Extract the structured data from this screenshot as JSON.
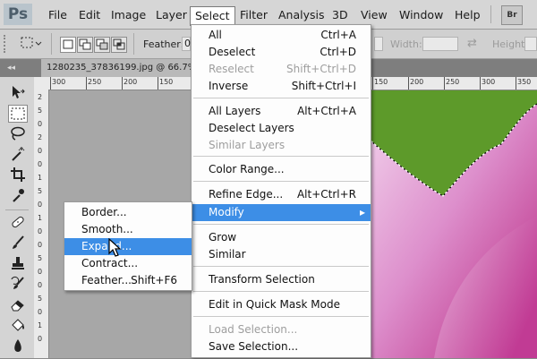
{
  "app": {
    "logo": "Ps"
  },
  "menubar": {
    "items": [
      "File",
      "Edit",
      "Image",
      "Layer",
      "Select",
      "Filter",
      "Analysis",
      "3D",
      "View",
      "Window",
      "Help"
    ],
    "bridge": "Br"
  },
  "options_bar": {
    "feather_label": "Feather:",
    "feather_value": "0",
    "width_label": "Width:",
    "height_label": "Height:"
  },
  "document": {
    "tab_title": "1280235_37836199.jpg @ 66.7%"
  },
  "rulers": {
    "top": [
      "300",
      "250",
      "200",
      "150",
      "100",
      "50",
      "0",
      "50",
      "100",
      "150",
      "200",
      "250",
      "300",
      "350"
    ],
    "left": [
      "2",
      "5",
      "0",
      "2",
      "0",
      "0",
      "1",
      "5",
      "0",
      "1",
      "0",
      "0",
      "5",
      "0",
      "0",
      "5",
      "0",
      "1",
      "0"
    ]
  },
  "select_menu": {
    "items": [
      {
        "label": "All",
        "shortcut": "Ctrl+A",
        "disabled": false
      },
      {
        "label": "Deselect",
        "shortcut": "Ctrl+D",
        "disabled": false
      },
      {
        "label": "Reselect",
        "shortcut": "Shift+Ctrl+D",
        "disabled": true
      },
      {
        "label": "Inverse",
        "shortcut": "Shift+Ctrl+I",
        "disabled": false
      },
      {
        "label": "All Layers",
        "shortcut": "Alt+Ctrl+A",
        "disabled": false
      },
      {
        "label": "Deselect Layers",
        "shortcut": "",
        "disabled": false
      },
      {
        "label": "Similar Layers",
        "shortcut": "",
        "disabled": true
      },
      {
        "label": "Color Range...",
        "shortcut": "",
        "disabled": false
      },
      {
        "label": "Refine Edge...",
        "shortcut": "Alt+Ctrl+R",
        "disabled": false
      },
      {
        "label": "Modify",
        "shortcut": "",
        "disabled": false,
        "highlighted": true,
        "submenu_arrow": "▸"
      },
      {
        "label": "Grow",
        "shortcut": "",
        "disabled": false
      },
      {
        "label": "Similar",
        "shortcut": "",
        "disabled": false
      },
      {
        "label": "Transform Selection",
        "shortcut": "",
        "disabled": false
      },
      {
        "label": "Edit in Quick Mask Mode",
        "shortcut": "",
        "disabled": false
      },
      {
        "label": "Load Selection...",
        "shortcut": "",
        "disabled": true
      },
      {
        "label": "Save Selection...",
        "shortcut": "",
        "disabled": false
      }
    ]
  },
  "modify_submenu": {
    "items": [
      {
        "label": "Border...",
        "shortcut": ""
      },
      {
        "label": "Smooth...",
        "shortcut": ""
      },
      {
        "label": "Expand...",
        "shortcut": "",
        "highlighted": true
      },
      {
        "label": "Contract...",
        "shortcut": ""
      },
      {
        "label": "Feather...",
        "shortcut": "Shift+F6"
      }
    ]
  },
  "colors": {
    "highlight": "#3d8ee6",
    "canvas_green": "#5d9a2a",
    "petal_magenta": "#c8338f",
    "petal_light": "#ecc0e2"
  }
}
